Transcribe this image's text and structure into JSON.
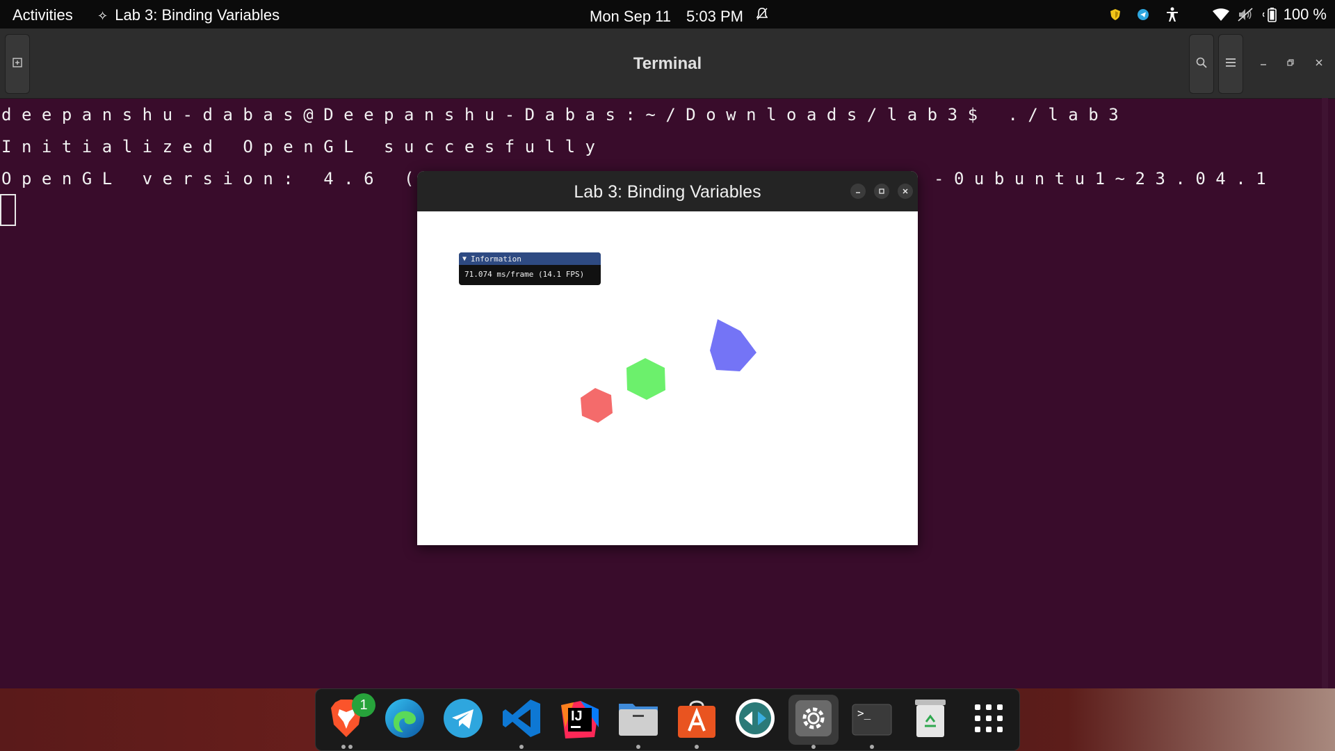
{
  "topbar": {
    "activities": "Activities",
    "app_title": "Lab 3: Binding Variables",
    "date": "Mon Sep 11",
    "time": "5:03 PM",
    "battery_percent": "100 %"
  },
  "terminal": {
    "title": "Terminal",
    "lines": [
      "deepanshu-dabas@Deepanshu-Dabas:~/Downloads/lab3$ ./lab3",
      "Initialized OpenGL succesfully",
      "OpenGL version: 4.6 (Comp",
      "-0ubuntu1~23.04.1"
    ]
  },
  "lab_window": {
    "title": "Lab 3: Binding Variables",
    "info_panel": {
      "header": "Information",
      "stats": "71.074 ms/frame (14.1 FPS)"
    },
    "shapes": [
      {
        "name": "red-hexagon",
        "color": "#f46b6b"
      },
      {
        "name": "green-hexagon",
        "color": "#6cf06c"
      },
      {
        "name": "blue-hexagon",
        "color": "#7474f6"
      }
    ]
  },
  "dock": {
    "items": [
      {
        "name": "brave-browser",
        "badge": "1"
      },
      {
        "name": "microsoft-edge"
      },
      {
        "name": "telegram"
      },
      {
        "name": "vscode"
      },
      {
        "name": "intellij-idea",
        "label": "IJ"
      },
      {
        "name": "files"
      },
      {
        "name": "app-center"
      },
      {
        "name": "remote-desktop"
      },
      {
        "name": "settings"
      },
      {
        "name": "terminal",
        "label": ">_"
      },
      {
        "name": "trash"
      },
      {
        "name": "show-apps"
      }
    ]
  },
  "colors": {
    "terminal_bg": "#390c2b",
    "topbar_bg": "#0b0b0b",
    "imgui_header": "#2e4a82"
  }
}
